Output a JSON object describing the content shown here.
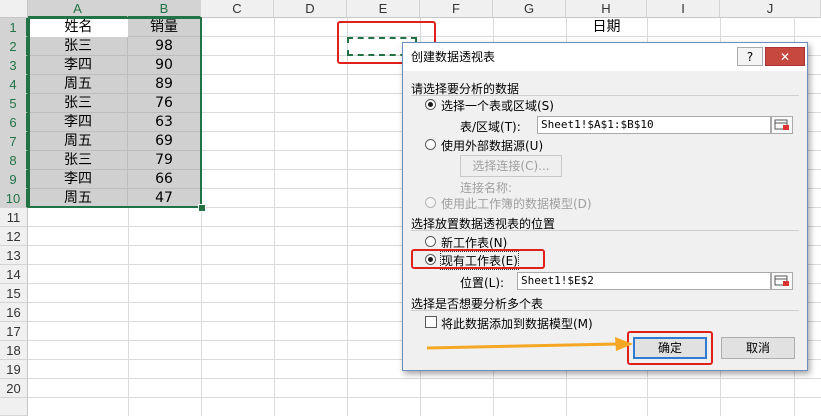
{
  "sheet": {
    "columns": [
      "A",
      "B",
      "C",
      "D",
      "E",
      "F",
      "G",
      "H",
      "I",
      "J"
    ],
    "rows": [
      "1",
      "2",
      "3",
      "4",
      "5",
      "6",
      "7",
      "8",
      "9",
      "10",
      "11",
      "12",
      "13",
      "14",
      "15",
      "16",
      "17",
      "18",
      "19",
      "20"
    ],
    "header_row": [
      "姓名",
      "销量"
    ],
    "data": [
      [
        "张三",
        "98"
      ],
      [
        "李四",
        "90"
      ],
      [
        "周五",
        "89"
      ],
      [
        "张三",
        "76"
      ],
      [
        "李四",
        "63"
      ],
      [
        "周五",
        "69"
      ],
      [
        "张三",
        "79"
      ],
      [
        "李四",
        "66"
      ],
      [
        "周五",
        "47"
      ]
    ],
    "h1": "日期"
  },
  "dialog": {
    "title": "创建数据透视表",
    "help_label": "?",
    "close_label": "✕",
    "section1": "请选择要分析的数据",
    "opt_table": "选择一个表或区域(S)",
    "table_label": "表/区域(T):",
    "table_value": "Sheet1!$A$1:$B$10",
    "opt_external": "使用外部数据源(U)",
    "choose_conn": "选择连接(C)...",
    "conn_name": "连接名称:",
    "opt_model": "使用此工作簿的数据模型(D)",
    "section2": "选择放置数据透视表的位置",
    "opt_new": "新工作表(N)",
    "opt_existing": "现有工作表(E)",
    "location_label": "位置(L):",
    "location_value": "Sheet1!$E$2",
    "section3": "选择是否想要分析多个表",
    "add_model": "将此数据添加到数据模型(M)",
    "ok": "确定",
    "cancel": "取消"
  },
  "colors": {
    "accent": "#217346",
    "highlight": "#e0201a",
    "arrow": "#f5a623"
  }
}
